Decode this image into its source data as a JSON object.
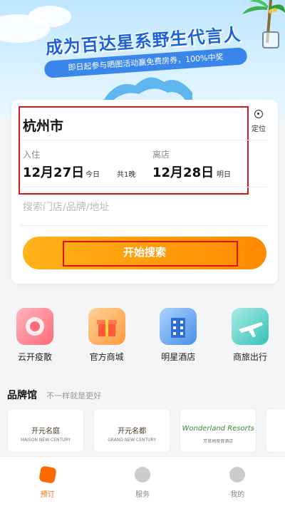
{
  "banner": {
    "title": "成为百达星系野生代言人",
    "subtitle": "即日起参与晒图活动赢免费房券，100%中奖"
  },
  "search": {
    "city": "杭州市",
    "locate_label": "定位",
    "checkin_label": "入住",
    "checkin_date": "12月27日",
    "checkin_day": "今日",
    "nights": "共1晚",
    "checkout_label": "离店",
    "checkout_date": "12月28日",
    "checkout_day": "明日",
    "placeholder": "搜索门店/品牌/地址",
    "button_label": "开始搜索"
  },
  "quick_entries": [
    {
      "label": "云开疫散",
      "icon": "cloud-icon",
      "color": "#ff6b7a"
    },
    {
      "label": "官方商城",
      "icon": "gift-icon",
      "color": "#ff9b3d"
    },
    {
      "label": "明星酒店",
      "icon": "building-icon",
      "color": "#4a8fe8"
    },
    {
      "label": "商旅出行",
      "icon": "airplane-icon",
      "color": "#36c2b8"
    }
  ],
  "brand_hall": {
    "title": "品牌馆",
    "subtitle": "不一样就是更好",
    "brands": [
      {
        "name": "开元名庭",
        "sub": "MAISON NEW CENTURY"
      },
      {
        "name": "开元名都",
        "sub": "GRAND NEW CENTURY"
      },
      {
        "name": "Wonderland Resorts",
        "sub": "芳草地度假酒店"
      }
    ]
  },
  "tabbar": {
    "items": [
      {
        "label": "预订",
        "active": true
      },
      {
        "label": "服务",
        "active": false
      },
      {
        "label": "我的",
        "active": false
      }
    ]
  },
  "colors": {
    "accent": "#ff8a00",
    "highlight_border": "#e0141e",
    "banner_blue": "#1e63d6"
  }
}
